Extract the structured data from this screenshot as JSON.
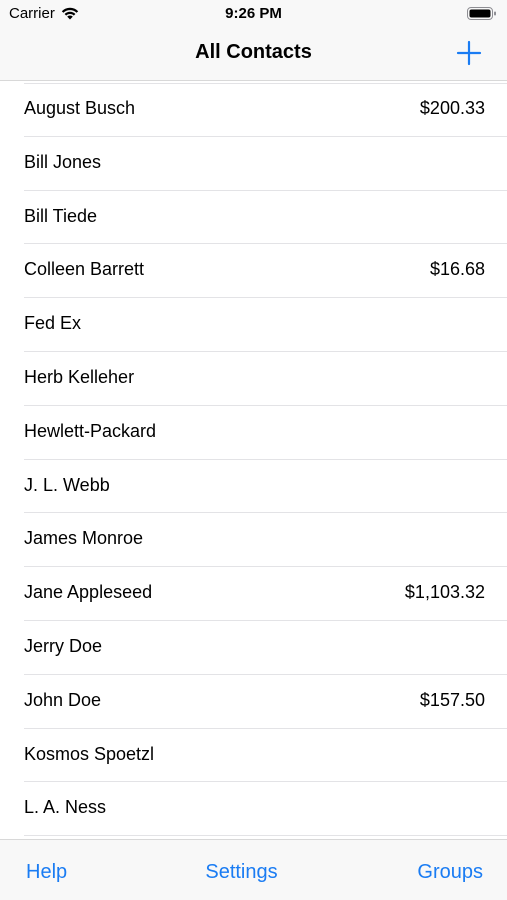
{
  "status_bar": {
    "carrier": "Carrier",
    "time": "9:26 PM",
    "wifi_icon": "wifi-icon",
    "battery_icon": "battery-icon"
  },
  "nav": {
    "title": "All Contacts",
    "add_icon": "plus-icon",
    "accent_color": "#1a7cf3"
  },
  "contacts": [
    {
      "name": "August Busch",
      "amount": "$200.33"
    },
    {
      "name": "Bill Jones",
      "amount": ""
    },
    {
      "name": "Bill Tiede",
      "amount": ""
    },
    {
      "name": "Colleen Barrett",
      "amount": "$16.68"
    },
    {
      "name": "Fed Ex",
      "amount": ""
    },
    {
      "name": "Herb Kelleher",
      "amount": ""
    },
    {
      "name": "Hewlett-Packard",
      "amount": ""
    },
    {
      "name": "J. L. Webb",
      "amount": ""
    },
    {
      "name": "James Monroe",
      "amount": ""
    },
    {
      "name": "Jane Appleseed",
      "amount": "$1,103.32"
    },
    {
      "name": "Jerry Doe",
      "amount": ""
    },
    {
      "name": "John Doe",
      "amount": "$157.50"
    },
    {
      "name": "Kosmos Spoetzl",
      "amount": ""
    },
    {
      "name": "L. A. Ness",
      "amount": ""
    }
  ],
  "toolbar": {
    "help_label": "Help",
    "settings_label": "Settings",
    "groups_label": "Groups"
  }
}
